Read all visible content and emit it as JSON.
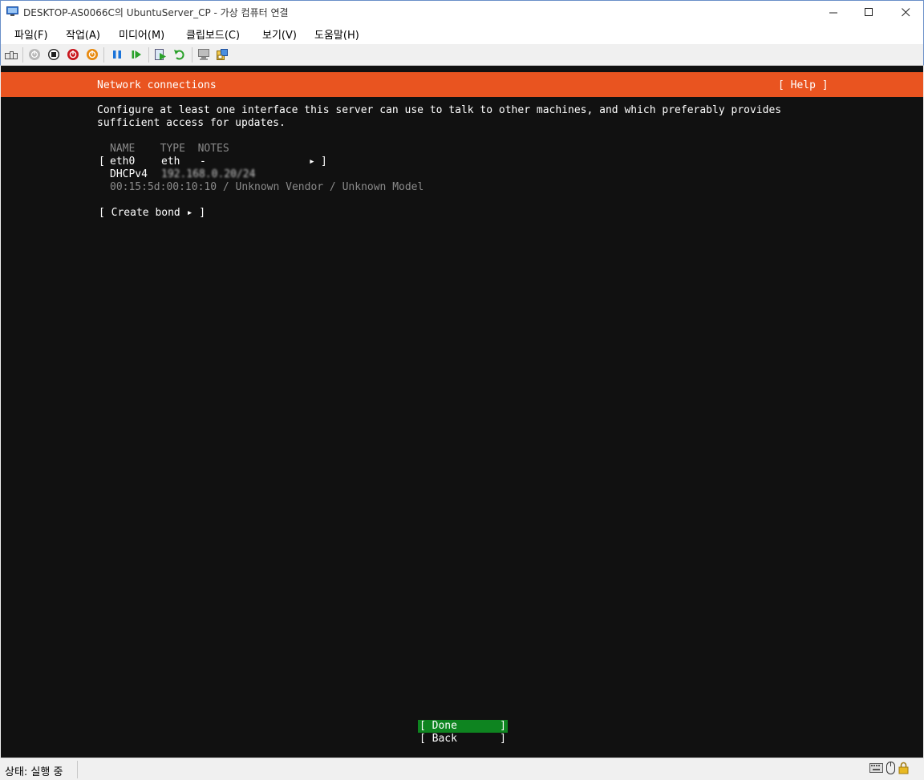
{
  "window": {
    "title": "DESKTOP-AS0066C의 UbuntuServer_CP - 가상 컴퓨터 연결",
    "minimize": "—",
    "maximize": "☐",
    "close": "✕"
  },
  "menu": {
    "items": [
      {
        "label": "파일(F)"
      },
      {
        "label": "작업(A)"
      },
      {
        "label": "미디어(M)"
      },
      {
        "label": "클립보드(C)"
      },
      {
        "label": "보기(V)"
      },
      {
        "label": "도움말(H)"
      }
    ]
  },
  "toolbar": {
    "icons": [
      "ctrl-alt-del-icon",
      "start-icon",
      "turn-off-icon",
      "shut-down-icon",
      "save-icon",
      "pause-icon",
      "resume-icon",
      "checkpoint-icon",
      "revert-icon",
      "enhanced-session-icon",
      "share-icon"
    ]
  },
  "console": {
    "header_title": "Network connections",
    "header_help": "[ Help ]",
    "description_line1": "Configure at least one interface this server can use to talk to other machines, and which preferably provides",
    "description_line2": "sufficient access for updates.",
    "table_header": "NAME    TYPE  NOTES",
    "interface": {
      "open_bracket": "[",
      "name": "eth0",
      "type": "eth",
      "notes": "-",
      "arrow": "▸",
      "close_bracket": "]",
      "dhcp_label": "DHCPv4",
      "dhcp_address": "192.168.0.20/24",
      "mac_info": "00:15:5d:00:10:10 / Unknown Vendor / Unknown Model"
    },
    "create_bond": "[ Create bond ▸ ]",
    "done_open": "[ Done",
    "done_close": "]",
    "back_open": "[ Back",
    "back_close": "]"
  },
  "status": {
    "text": "상태: 실행 중"
  },
  "colors": {
    "ubuntu_orange": "#e95420",
    "done_green": "#0e8420",
    "console_bg": "#111111"
  }
}
